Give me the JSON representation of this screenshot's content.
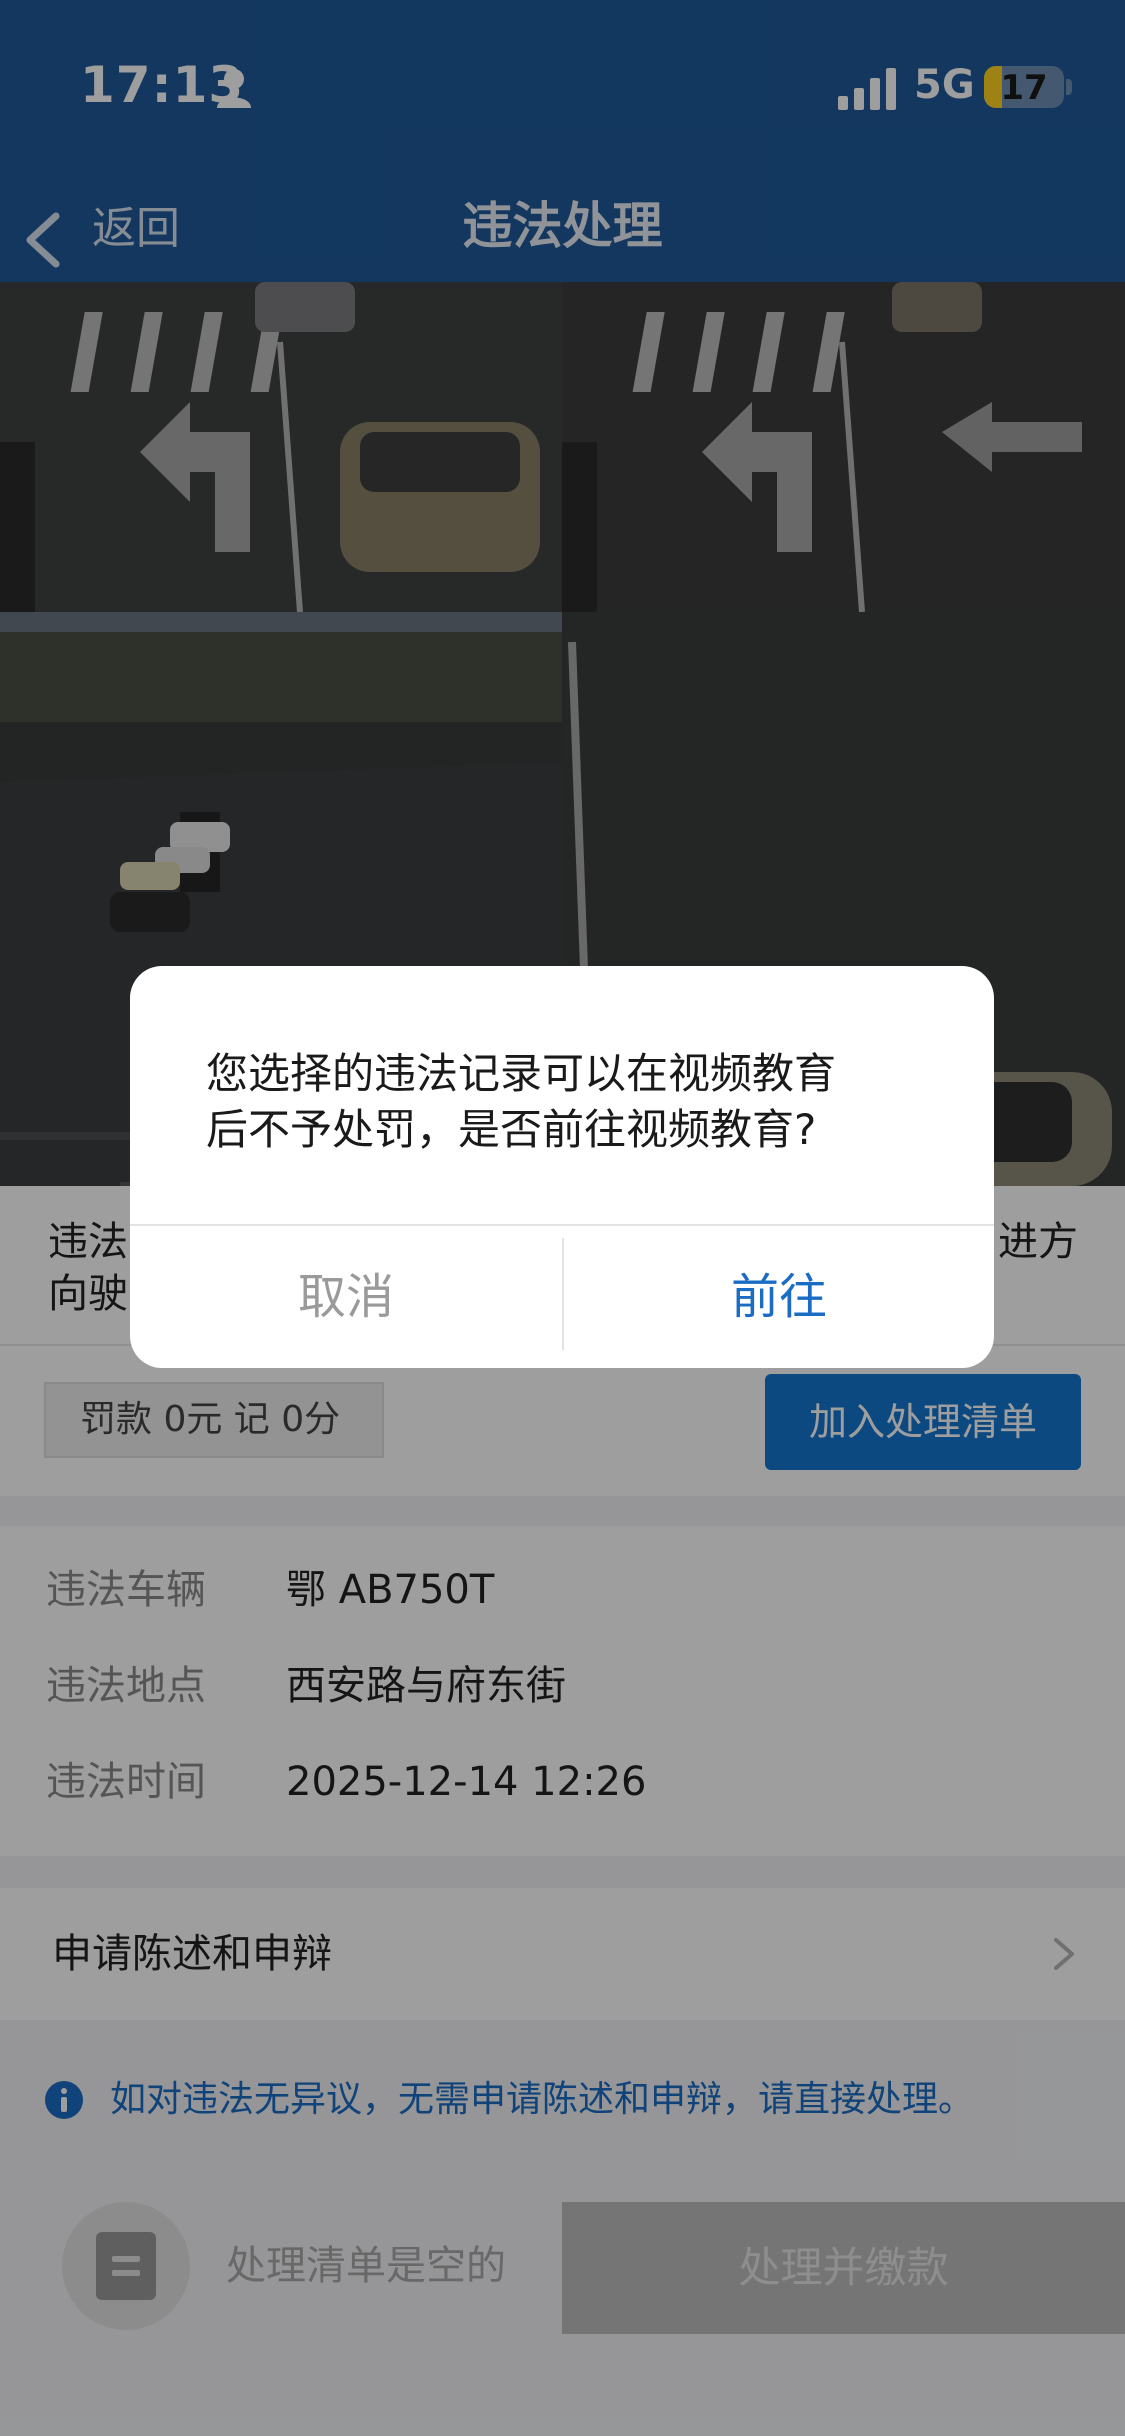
{
  "status_bar": {
    "time": "17:13",
    "network": "5G",
    "battery": "17"
  },
  "nav": {
    "back_label": "返回",
    "title": "违法处理"
  },
  "violation": {
    "description_start": "违法",
    "description_line2_start": "向驶",
    "description_end": "进方",
    "penalty": "罚款 0元  记 0分",
    "add_button": "加入处理清单"
  },
  "details": [
    {
      "label": "违法车辆",
      "value": "鄂 AB750T"
    },
    {
      "label": "违法地点",
      "value": "西安路与府东街"
    },
    {
      "label": "违法时间",
      "value": "2025-12-14 12:26"
    }
  ],
  "appeal": {
    "label": "申请陈述和申辩"
  },
  "notice": {
    "text": "如对违法无异议，无需申请陈述和申辩，请直接处理。"
  },
  "bottom": {
    "empty_text": "处理清单是空的",
    "pay_button": "处理并缴款"
  },
  "dialog": {
    "message_line1": "您选择的违法记录可以在视频教育",
    "message_line2": "后不予处罚，是否前往视频教育?",
    "cancel": "取消",
    "confirm": "前往"
  },
  "colors": {
    "header": "#1f5a99",
    "accent": "#1677d0",
    "link": "#1a6cc4"
  }
}
